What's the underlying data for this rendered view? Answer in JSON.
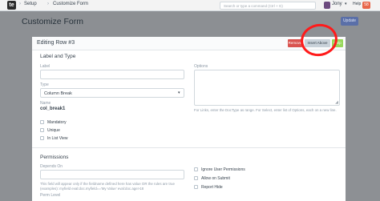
{
  "navbar": {
    "logo": "te",
    "breadcrumbs": [
      "Setup",
      "Customize Form"
    ],
    "search_placeholder": "Search or type a command (Ctrl + G)",
    "user_name": "Jony",
    "help_label": "Help",
    "help_badge": "58"
  },
  "page": {
    "title": "Customize Form",
    "update_label": "Update"
  },
  "modal": {
    "title": "Editing Row #3",
    "remove_label": "Remove",
    "insert_above_label": "Insert Above",
    "help_label": "Help",
    "sections": {
      "label_type": "Label and Type",
      "permissions": "Permissions"
    },
    "fields": {
      "label": {
        "label": "Label",
        "value": ""
      },
      "type": {
        "label": "Type",
        "value": "Column Break"
      },
      "name": {
        "label": "Name",
        "value": "col_break1"
      },
      "options": {
        "label": "Options",
        "help": "For Links, enter the DocType as range. For Select, enter list of Options, each on a new line."
      },
      "depends_on": {
        "label": "Depends On",
        "help_line1": "This field will appear only if the fieldname defined here has value OR the rules are true",
        "help_line2": "(examples): myfield eval:doc.myfield=='My Value' eval:doc.age>18"
      },
      "perm_level": {
        "label": "Perm Level"
      }
    },
    "checkboxes_left": [
      "Mandatory",
      "Unique",
      "In List View"
    ],
    "checkboxes_right": [
      "Ignore User Permissions",
      "Allow on Submit",
      "Report Hide"
    ]
  },
  "colors": {
    "remove": "#d9534f",
    "help": "#98d85b",
    "primary": "#5a6fa8",
    "annotation": "#ff1a1a"
  }
}
